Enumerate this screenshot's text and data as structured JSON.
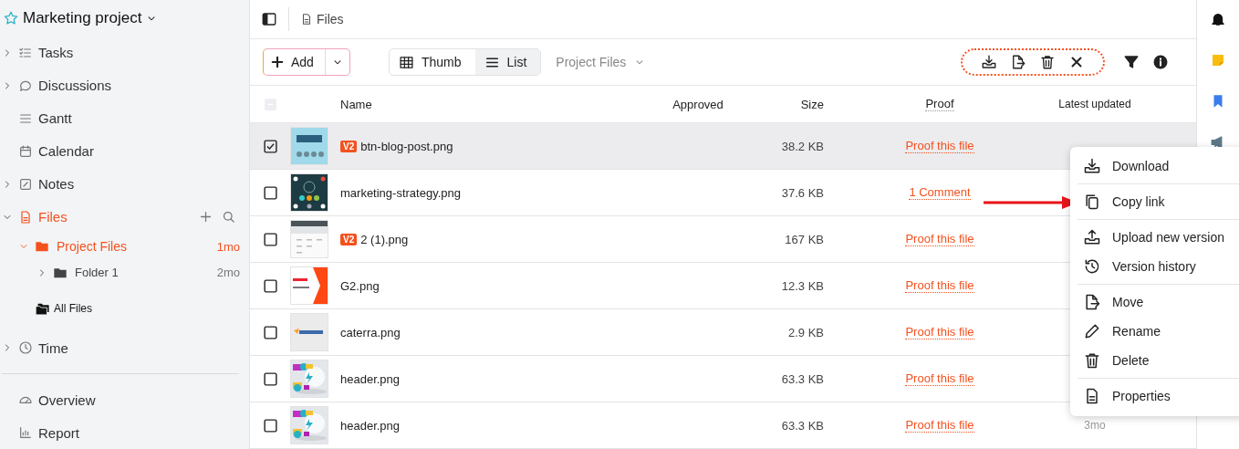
{
  "sidebar": {
    "project": {
      "title": "Marketing project"
    },
    "items": [
      {
        "label": "Tasks",
        "expanded": false,
        "selected": false
      },
      {
        "label": "Discussions",
        "expanded": false,
        "selected": false
      },
      {
        "label": "Gantt",
        "selected": false
      },
      {
        "label": "Calendar",
        "selected": false
      },
      {
        "label": "Notes",
        "expanded": false,
        "selected": false
      },
      {
        "label": "Files",
        "expanded": true,
        "selected": true,
        "children": [
          {
            "label": "Project Files",
            "time": "1mo",
            "expanded": true,
            "selected": true,
            "children": [
              {
                "label": "Folder 1",
                "time": "2mo",
                "expanded": false,
                "selected": false
              }
            ]
          }
        ],
        "all_files": "All Files"
      },
      {
        "label": "Time",
        "expanded": false,
        "selected": false
      }
    ],
    "bottom_items": [
      {
        "label": "Overview"
      },
      {
        "label": "Report"
      }
    ]
  },
  "breadcrumb": {
    "label": "Files"
  },
  "toolbar": {
    "add_label": "Add",
    "views": [
      {
        "label": "Thumb",
        "selected": false
      },
      {
        "label": "List",
        "selected": true
      }
    ],
    "folder_dropdown": "Project Files"
  },
  "table": {
    "select_all_indeterminate": true,
    "columns": [
      "Name",
      "Approved",
      "Size",
      "Proof",
      "Latest updated"
    ],
    "rows": [
      {
        "name": "btn-blog-post.png",
        "version": "V2",
        "size": "38.2 KB",
        "proof": "Proof this file",
        "checked": true
      },
      {
        "name": "marketing-strategy.png",
        "size": "37.6 KB",
        "proof": "1 Comment",
        "checked": false
      },
      {
        "name": "2 (1).png",
        "version": "V2",
        "size": "167 KB",
        "proof": "Proof this file",
        "checked": false
      },
      {
        "name": "G2.png",
        "size": "12.3 KB",
        "proof": "Proof this file",
        "checked": false
      },
      {
        "name": "caterra.png",
        "size": "2.9 KB",
        "proof": "Proof this file",
        "checked": false
      },
      {
        "name": "header.png",
        "size": "63.3 KB",
        "proof": "Proof this file",
        "checked": false
      },
      {
        "name": "header.png",
        "size": "63.3 KB",
        "proof": "Proof this file",
        "updated": "3mo",
        "checked": false
      }
    ]
  },
  "context_menu": {
    "groups": [
      [
        "Download"
      ],
      [
        "Copy link"
      ],
      [
        "Upload new version",
        "Version history"
      ],
      [
        "Move",
        "Rename",
        "Delete"
      ],
      [
        "Properties"
      ]
    ]
  }
}
